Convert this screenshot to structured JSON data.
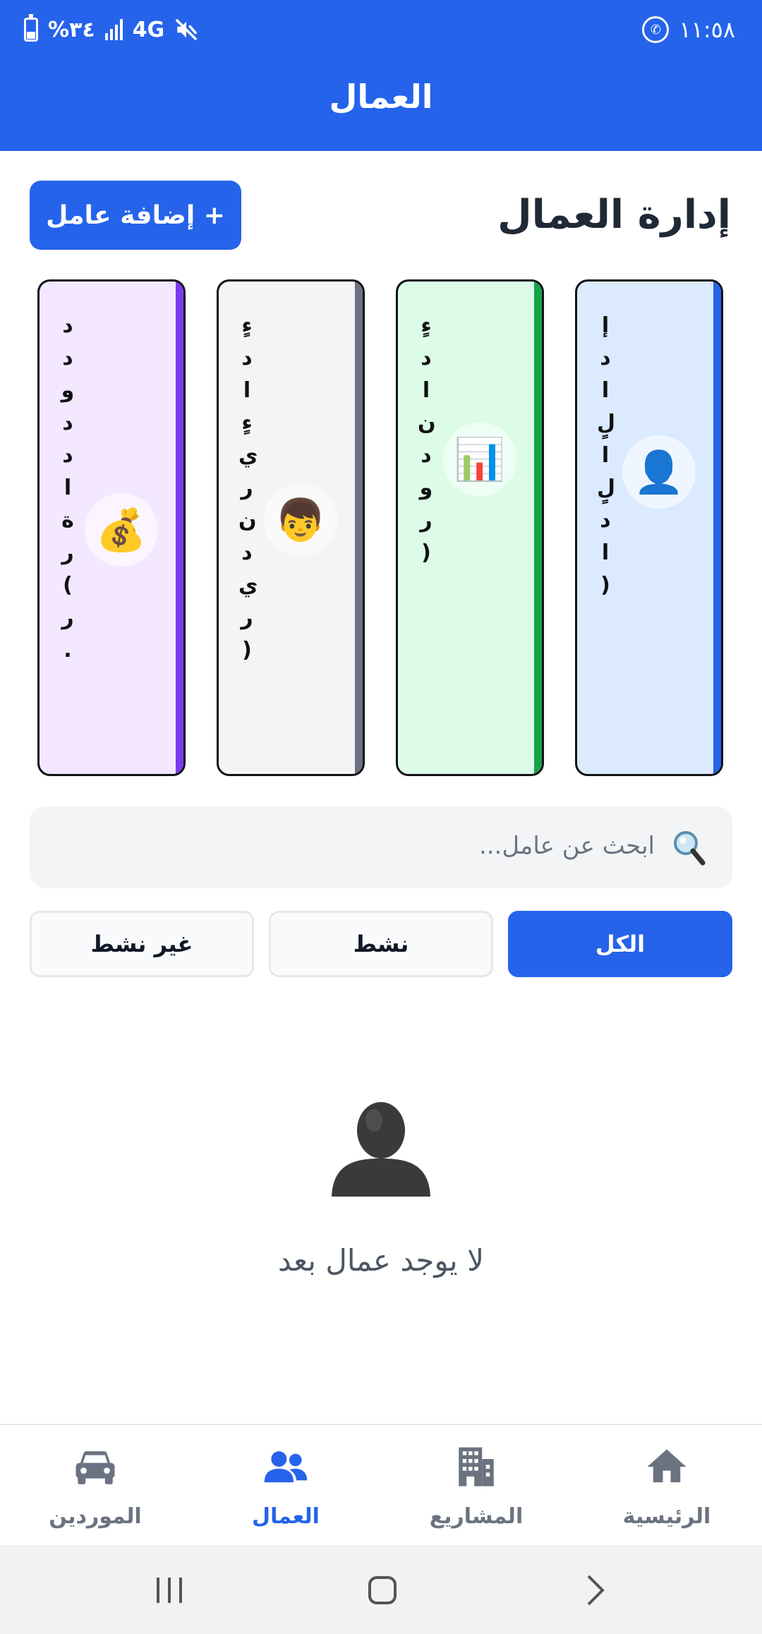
{
  "status_bar": {
    "time": "١١:٥٨",
    "battery_percent": "%٣٤",
    "network": "4G"
  },
  "app_bar": {
    "title": "العمال"
  },
  "page": {
    "heading": "إدارة العمال",
    "add_button_label": "+ إضافة عامل"
  },
  "stat_cards": [
    {
      "icon": "bust-in-silhouette-icon",
      "glyph": "👤",
      "text": "إ د ا لٍ  ا لٍ د ا )",
      "color": "#dbeafe",
      "accent": "#2563eb"
    },
    {
      "icon": "bar-chart-icon",
      "glyph": "📊",
      "text": "ءٍ د ا  ن د و ر )",
      "color": "#dcfce7",
      "accent": "#16a34a"
    },
    {
      "icon": "man-face-icon",
      "glyph": "👦",
      "text": "ءٍ د ا  ءٍ ي ر  ن د ي ر )",
      "color": "#f3f4f6",
      "accent": "#6b7280"
    },
    {
      "icon": "money-bag-icon",
      "glyph": "💰",
      "text": "د د و د د  ا ة ر )  ر .",
      "color": "#f3e8ff",
      "accent": "#7c3aed"
    }
  ],
  "search": {
    "placeholder": "ابحث عن عامل..."
  },
  "filters": [
    {
      "label": "الكل",
      "active": true
    },
    {
      "label": "نشط",
      "active": false
    },
    {
      "label": "غير نشط",
      "active": false
    }
  ],
  "empty_state": {
    "message": "لا يوجد عمال بعد"
  },
  "bottom_nav": {
    "items": [
      {
        "label": "الرئيسية",
        "icon": "home-icon",
        "active": false
      },
      {
        "label": "المشاريع",
        "icon": "building-icon",
        "active": false
      },
      {
        "label": "العمال",
        "icon": "users-icon",
        "active": true
      },
      {
        "label": "الموردين",
        "icon": "car-icon",
        "active": false
      }
    ]
  },
  "colors": {
    "primary": "#2563eb",
    "inactive_nav": "#6b7280",
    "search_bg": "#f3f4f6"
  }
}
